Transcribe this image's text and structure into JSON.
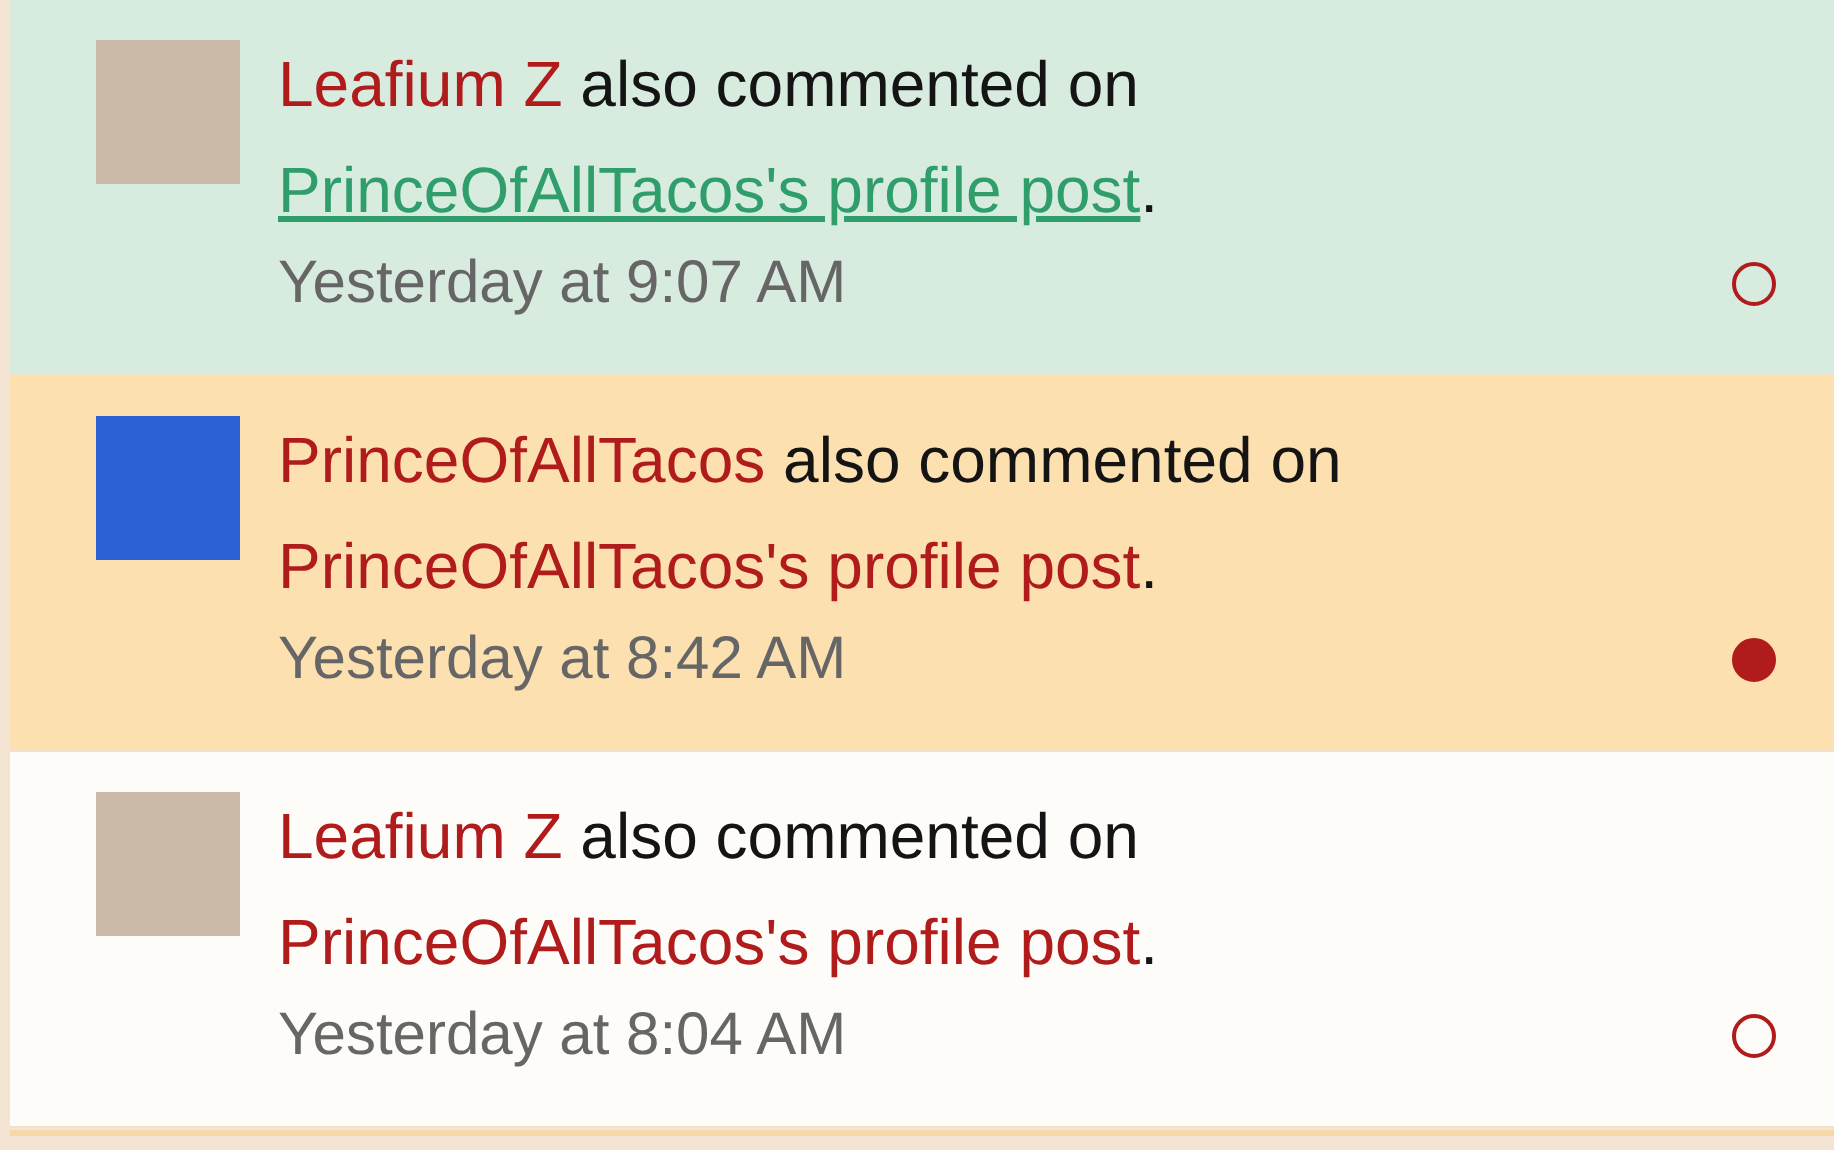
{
  "notifications": [
    {
      "actor": "Leafium Z",
      "action": "also commented on",
      "link": "PrinceOfAllTacos's profile post",
      "end": ".",
      "time": "Yesterday at 9:07 AM",
      "unread": false,
      "hovered": true,
      "kind": "photo"
    },
    {
      "actor": "PrinceOfAllTacos",
      "action": "also commented on",
      "link": "PrinceOfAllTacos's profile post",
      "end": ".",
      "time": "Yesterday at 8:42 AM",
      "unread": true,
      "hovered": false,
      "kind": "drawing"
    },
    {
      "actor": "Leafium Z",
      "action": "also commented on",
      "link": "PrinceOfAllTacos's profile post",
      "end": ".",
      "time": "Yesterday at 8:04 AM",
      "unread": false,
      "hovered": false,
      "kind": "photo"
    }
  ]
}
